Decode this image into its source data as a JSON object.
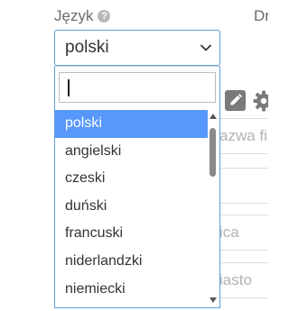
{
  "language_field": {
    "label": "Język",
    "help_icon": "question-circle-icon",
    "selected_value": "polski",
    "chevron_icon": "chevron-down-icon"
  },
  "adjacent_field": {
    "label": "Dr"
  },
  "dropdown": {
    "search": {
      "value": "",
      "placeholder": ""
    },
    "options": [
      {
        "label": "polski",
        "highlighted": true
      },
      {
        "label": "angielski",
        "highlighted": false
      },
      {
        "label": "czeski",
        "highlighted": false
      },
      {
        "label": "duński",
        "highlighted": false
      },
      {
        "label": "francuski",
        "highlighted": false
      },
      {
        "label": "niderlandzki",
        "highlighted": false
      },
      {
        "label": "niemiecki",
        "highlighted": false
      }
    ],
    "scroll_progress": 0
  },
  "background_form": {
    "edit_icon": "pencil-icon",
    "settings_icon": "gear-icon",
    "fields": [
      {
        "placeholder": "azwa fi"
      },
      {
        "placeholder": ""
      },
      {
        "placeholder": "ica"
      },
      {
        "placeholder": "iasto"
      }
    ]
  },
  "colors": {
    "highlight": "#5897fb",
    "focus_border": "#5a9fdf",
    "label_text": "#6b6b6b"
  }
}
